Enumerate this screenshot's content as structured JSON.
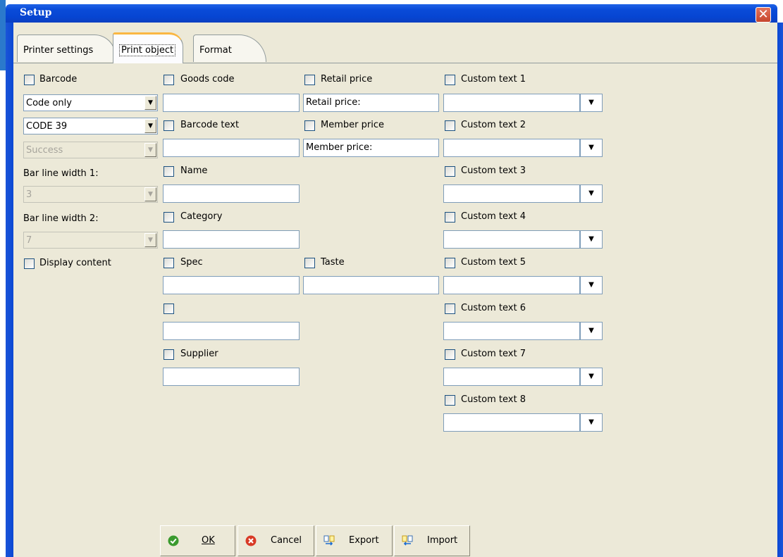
{
  "window": {
    "title": "Setup"
  },
  "tabs": [
    "Printer settings",
    "Print object",
    "Format"
  ],
  "col1": {
    "barcode_label": "Barcode",
    "type_combo": "Code only",
    "symbology_combo": "CODE 39",
    "status_combo": "Success",
    "bar_width1_label": "Bar line width 1:",
    "bar_width1_value": "3",
    "bar_width2_label": "Bar line width 2:",
    "bar_width2_value": "7",
    "display_content_label": "Display content"
  },
  "col2": {
    "goods_code_label": "Goods code",
    "goods_code_value": "",
    "barcode_text_label": "Barcode text",
    "barcode_text_value": "",
    "name_label": "Name",
    "name_value": "",
    "category_label": "Category",
    "category_value": "",
    "spec_label": "Spec",
    "spec_value": "",
    "unnamed_value": "",
    "supplier_label": "Supplier",
    "supplier_value": ""
  },
  "col3": {
    "retail_price_label": "Retail price",
    "retail_price_value": "Retail price:",
    "member_price_label": "Member price",
    "member_price_value": "Member price:",
    "taste_label": "Taste",
    "taste_value": ""
  },
  "col4": {
    "custom_texts": [
      "Custom text 1",
      "Custom text 2",
      "Custom text 3",
      "Custom text 4",
      "Custom text 5",
      "Custom text 6",
      "Custom text 7",
      "Custom text 8"
    ]
  },
  "buttons": {
    "ok": "OK",
    "cancel": "Cancel",
    "export": "Export",
    "import": "Import"
  }
}
